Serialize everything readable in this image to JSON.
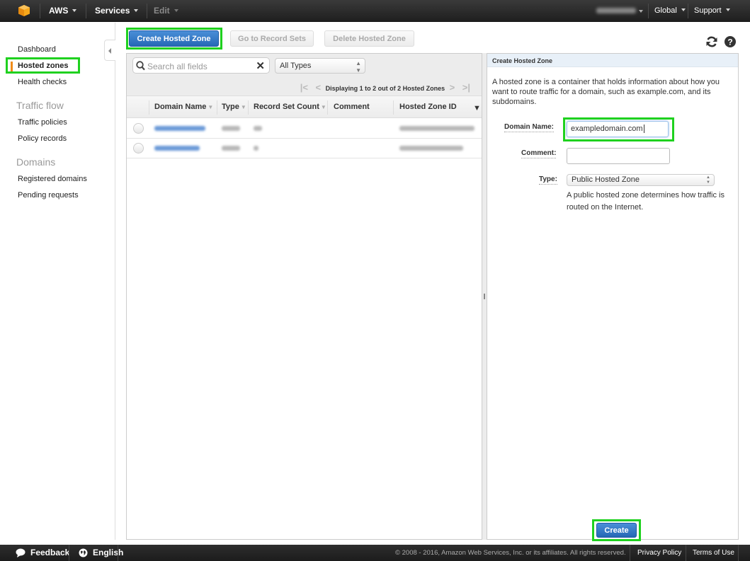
{
  "topnav": {
    "logo": "aws-cube-icon",
    "brand_label": "AWS",
    "services_label": "Services",
    "edit_label": "Edit",
    "region_label": "Global",
    "support_label": "Support"
  },
  "sidebar": {
    "items": [
      {
        "label": "Dashboard"
      },
      {
        "label": "Hosted zones",
        "active": true
      },
      {
        "label": "Health checks"
      }
    ],
    "sections": [
      {
        "title": "Traffic flow",
        "items": [
          {
            "label": "Traffic policies"
          },
          {
            "label": "Policy records"
          }
        ]
      },
      {
        "title": "Domains",
        "items": [
          {
            "label": "Registered domains"
          },
          {
            "label": "Pending requests"
          }
        ]
      }
    ]
  },
  "toolbar": {
    "create_label": "Create Hosted Zone",
    "record_sets_label": "Go to Record Sets",
    "delete_label": "Delete Hosted Zone",
    "refresh_icon": "refresh-icon",
    "help_icon": "help-icon"
  },
  "list": {
    "search_placeholder": "Search all fields",
    "type_filter": "All Types",
    "pager_text": "Displaying 1 to 2 out of 2 Hosted Zones",
    "columns": [
      "Domain Name",
      "Type",
      "Record Set Count",
      "Comment",
      "Hosted Zone ID"
    ],
    "rows_note": "row values are blurred in screenshot",
    "row_count": 2
  },
  "detail": {
    "title": "Create Hosted Zone",
    "description": "A hosted zone is a container that holds information about how you want to route traffic for a domain, such as example.com, and its subdomains.",
    "domain_label": "Domain Name:",
    "domain_value": "exampledomain.com",
    "comment_label": "Comment:",
    "comment_value": "",
    "type_label": "Type:",
    "type_value": "Public Hosted Zone",
    "type_help": "A public hosted zone determines how traffic is routed on the Internet.",
    "create_button": "Create"
  },
  "footer": {
    "feedback_label": "Feedback",
    "language_label": "English",
    "copyright": "© 2008 - 2016, Amazon Web Services, Inc. or its affiliates. All rights reserved.",
    "privacy_label": "Privacy Policy",
    "terms_label": "Terms of Use"
  },
  "colors": {
    "highlight": "#1fd11f",
    "primary": "#2f77c8",
    "active_marker": "#f08c1a"
  }
}
